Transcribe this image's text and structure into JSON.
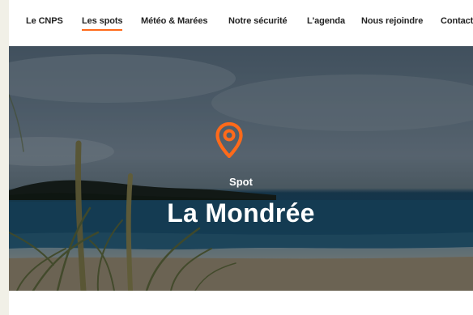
{
  "nav": {
    "items": [
      {
        "label": "Le CNPS",
        "active": false
      },
      {
        "label": "Les spots",
        "active": true
      },
      {
        "label": "Météo & Marées",
        "active": false
      },
      {
        "label": "Notre sécurité",
        "active": false
      },
      {
        "label": "L'agenda",
        "active": false
      },
      {
        "label": "Nous rejoindre",
        "active": false
      },
      {
        "label": "Contact",
        "active": false
      }
    ]
  },
  "hero": {
    "icon": "location-pin-icon",
    "kicker": "Spot",
    "title": "La Mondrée"
  },
  "colors": {
    "accent": "#ff6a1a",
    "nav_text": "#222222",
    "hero_text": "#ffffff"
  }
}
